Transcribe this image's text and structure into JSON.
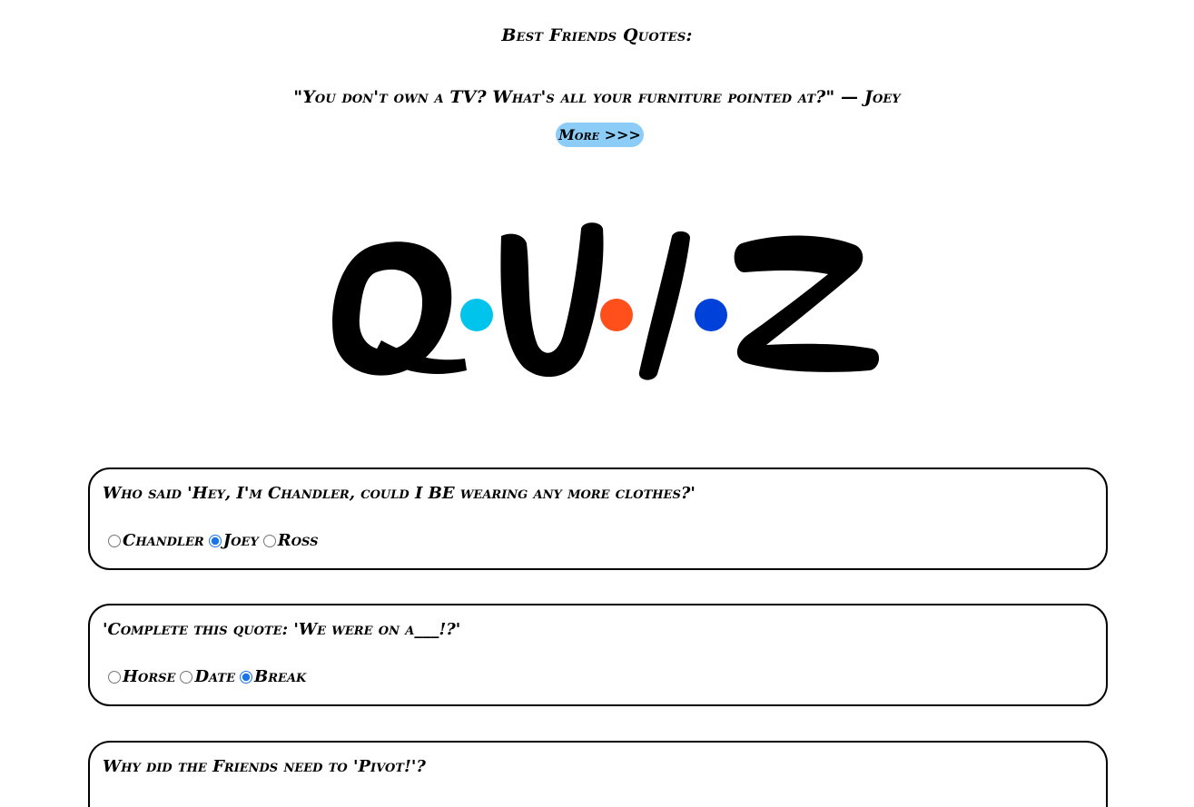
{
  "header": {
    "title": "Best Friends Quotes:",
    "quote": "\"You don't own a TV? What's all your furniture pointed at?\" — Joey",
    "more_label": "More >>>"
  },
  "logo": {
    "letters": [
      "Q",
      "U",
      "I",
      "Z"
    ],
    "dot_colors": [
      "#00c4eb",
      "#ff4f1a",
      "#0041d9"
    ]
  },
  "questions": [
    {
      "text": "Who said 'Hey, I'm Chandler, could I BE wearing any more clothes?'",
      "options": [
        "Chandler",
        "Joey",
        "Ross"
      ],
      "selected": "Joey"
    },
    {
      "text": "'Complete this quote: 'We were on a___!?'",
      "options": [
        "Horse",
        "Date",
        "Break"
      ],
      "selected": "Break"
    },
    {
      "text": "Why did the Friends need to 'Pivot!'?"
    }
  ]
}
